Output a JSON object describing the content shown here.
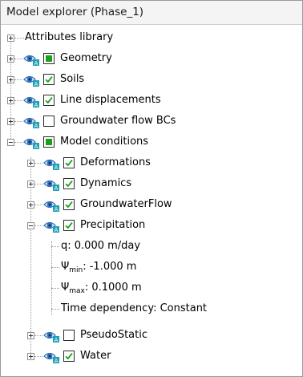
{
  "window": {
    "title": "Model explorer (Phase_1)"
  },
  "tree": {
    "attributes_library": "Attributes library",
    "geometry": "Geometry",
    "soils": "Soils",
    "line_displacements": "Line displacements",
    "groundwater_flow_bcs": "Groundwater flow BCs",
    "model_conditions": "Model conditions",
    "deformations": "Deformations",
    "dynamics": "Dynamics",
    "groundwaterflow": "GroundwaterFlow",
    "precipitation": "Precipitation",
    "precip_q": "q: 0.000 m/day",
    "psi_min_symbol": "Ψ",
    "psi_min_sub": "min",
    "psi_min_value": ": -1.000 m",
    "psi_max_symbol": "Ψ",
    "psi_max_sub": "max",
    "psi_max_value": ": 0.1000 m",
    "time_dependency": "Time dependency: Constant",
    "pseudostatic": "PseudoStatic",
    "water": "Water"
  },
  "colors": {
    "check_green": "#1aa11a",
    "eye_blue": "#2f6fb8",
    "eye_teal": "#1fa0b8"
  }
}
